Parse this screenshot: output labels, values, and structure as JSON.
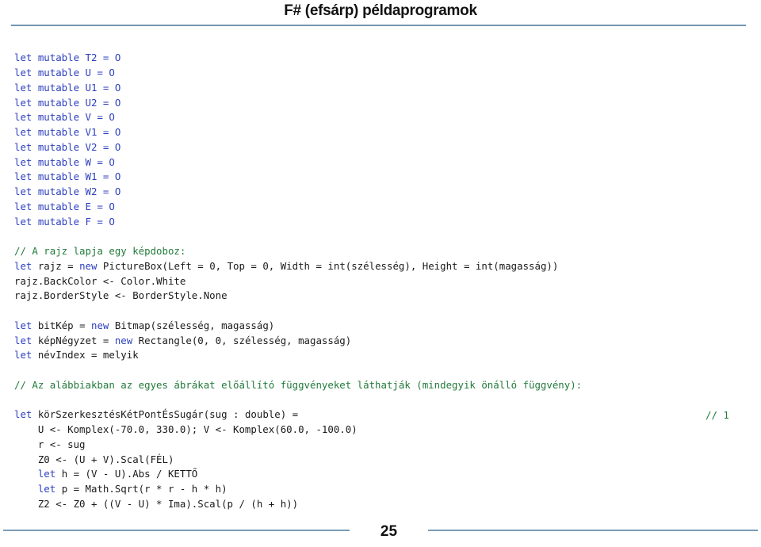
{
  "header": {
    "title": "F# (efsárp) példaprogramok"
  },
  "footer": {
    "page_number": "25"
  },
  "colors": {
    "keyword": "#2c3fbe",
    "comment": "#217a3a",
    "text": "#1a1a1a",
    "rule": "#7297b3"
  },
  "code": {
    "declarations": [
      "let mutable T2 = O",
      "let mutable U = O",
      "let mutable U1 = O",
      "let mutable U2 = O",
      "let mutable V = O",
      "let mutable V1 = O",
      "let mutable V2 = O",
      "let mutable W = O",
      "let mutable W1 = O",
      "let mutable W2 = O",
      "let mutable E = O",
      "let mutable F = O"
    ],
    "comment_picturebox": "// A rajz lapja egy képdoboz:",
    "picturebox_keyword_let": "let",
    "picturebox_name": " rajz = ",
    "picturebox_keyword_new": "new",
    "picturebox_rest": " PictureBox(Left = 0, Top = 0, Width = int(szélesség), Height = int(magasság))",
    "backcolor_line": "rajz.BackColor <- Color.White",
    "borderstyle_line": "rajz.BorderStyle <- BorderStyle.None",
    "bitmap_keyword_let": "let",
    "bitmap_name": " bitKép = ",
    "bitmap_keyword_new": "new",
    "bitmap_rest": " Bitmap(szélesség, magasság)",
    "rect_keyword_let": "let",
    "rect_name": " képNégyzet = ",
    "rect_keyword_new": "new",
    "rect_rest": " Rectangle(0, 0, szélesség, magasság)",
    "nevindex_keyword_let": "let",
    "nevindex_rest": " névIndex = melyik",
    "comment_functions": "// Az alábbiakban az egyes ábrákat előállító függvényeket láthatják (mindegyik önálló függvény):",
    "func_keyword_let": "let",
    "func_signature": " körSzerkesztésKétPontÉsSugár(sug : double) =",
    "func_note": "// 1",
    "body_line_1": "    U <- Komplex(-70.0, 330.0); V <- Komplex(60.0, -100.0)",
    "body_line_2": "    r <- sug",
    "body_line_3": "    Z0 <- (U + V).Scal(FÉL)",
    "body_line_4_indent": "    ",
    "body_line_4_keyword": "let",
    "body_line_4_rest": " h = (V - U).Abs / KETTŐ",
    "body_line_5_indent": "    ",
    "body_line_5_keyword": "let",
    "body_line_5_rest": " p = Math.Sqrt(r * r - h * h)",
    "body_line_6": "    Z2 <- Z0 + ((V - U) * Ima).Scal(p / (h + h))"
  }
}
